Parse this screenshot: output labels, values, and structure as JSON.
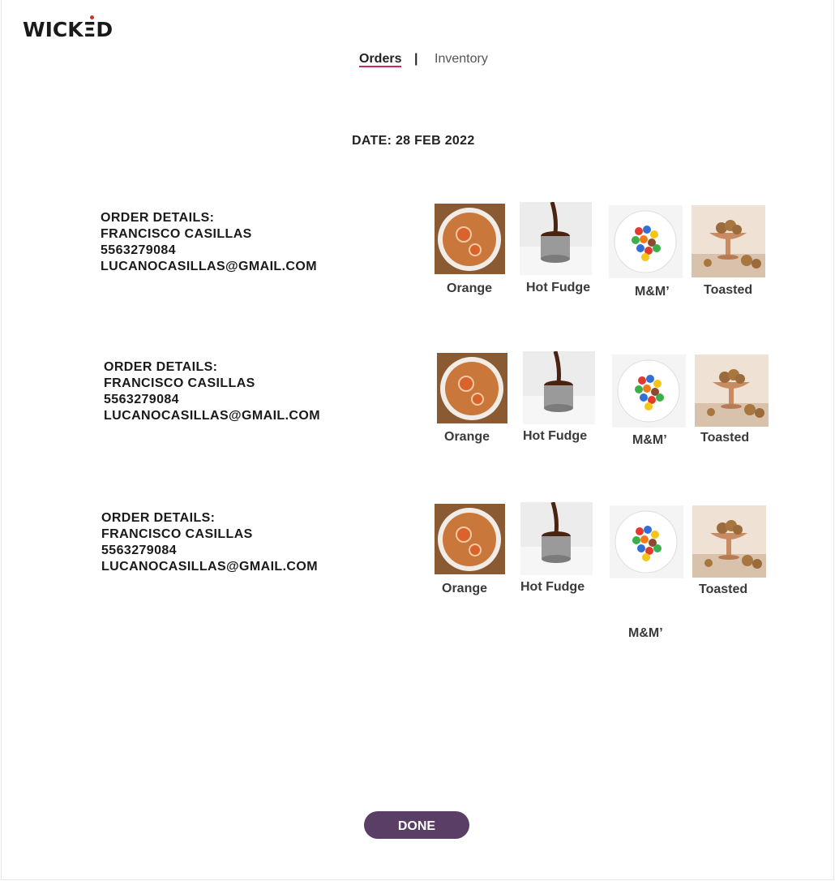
{
  "brand": {
    "logo_text": "WICKΞD"
  },
  "nav": {
    "orders": "Orders",
    "separator": "|",
    "inventory": "Inventory"
  },
  "date_label": "DATE: 28 FEB 2022",
  "orders": [
    {
      "details": [
        "ORDER DETAILS:",
        "FRANCISCO CASILLAS",
        "5563279084",
        "LUCANOCASILLAS@GMAIL.COM"
      ],
      "products": [
        "Orange",
        "Hot Fudge",
        "M&M’",
        "Toasted"
      ]
    },
    {
      "details": [
        "ORDER DETAILS:",
        "FRANCISCO CASILLAS",
        "5563279084",
        "LUCANOCASILLAS@GMAIL.COM"
      ],
      "products": [
        "Orange",
        "Hot Fudge",
        "M&M’",
        "Toasted"
      ]
    },
    {
      "details": [
        "ORDER DETAILS:",
        "FRANCISCO CASILLAS",
        "5563279084",
        "LUCANOCASILLAS@GMAIL.COM"
      ],
      "products": [
        "Orange",
        "Hot Fudge",
        "M&M’",
        "Toasted"
      ]
    }
  ],
  "product_images": [
    "orange-cake-image",
    "hot-fudge-image",
    "mms-candy-image",
    "toasted-walnuts-image"
  ],
  "done_label": "DONE",
  "colors": {
    "accent": "#5a3e66",
    "underline": "#c8285a",
    "logo_dot": "#d0312d"
  }
}
